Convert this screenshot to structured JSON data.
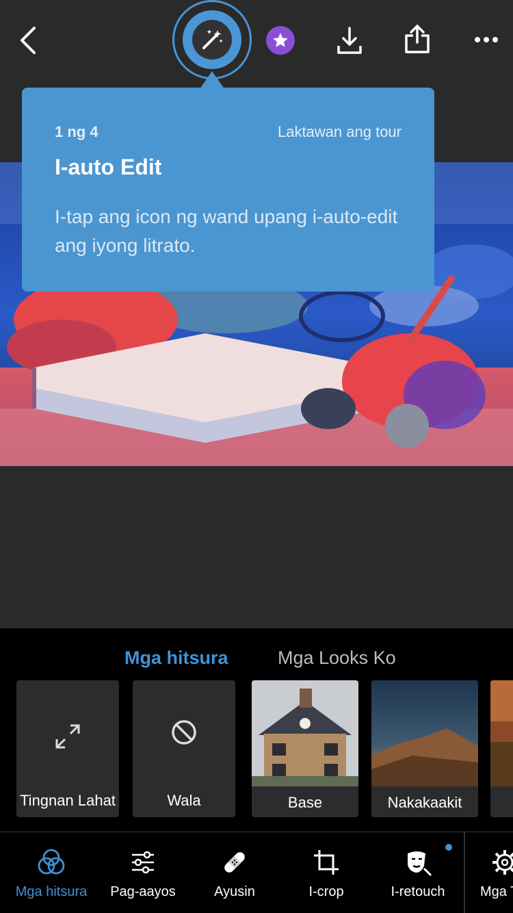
{
  "toolbar_top": {
    "icons": [
      "back-chevron-icon",
      "auto-wand-icon",
      "premium-star-icon",
      "download-icon",
      "share-icon",
      "more-icon"
    ]
  },
  "tooltip": {
    "step": "1 ng 4",
    "skip": "Laktawan ang tour",
    "title": "I-auto Edit",
    "body": "I-tap ang icon ng wand upang i-auto-edit ang iyong litrato."
  },
  "looks": {
    "tabs": [
      {
        "label": "Mga hitsura",
        "active": true
      },
      {
        "label": "Mga Looks Ko",
        "active": false
      }
    ],
    "cards": [
      {
        "label": "Tingnan Lahat",
        "icon": "expand-arrows-icon"
      },
      {
        "label": "Wala",
        "icon": "none-circle-icon"
      },
      {
        "label": "Base",
        "icon": "house-photo"
      },
      {
        "label": "Nakakaakit",
        "icon": "mountain-photo"
      }
    ]
  },
  "bottom_tools": [
    {
      "label": "Mga hitsura",
      "icon": "presets-circles-icon",
      "active": true
    },
    {
      "label": "Pag-aayos",
      "icon": "sliders-icon",
      "active": false
    },
    {
      "label": "Ayusin",
      "icon": "bandage-icon",
      "active": false
    },
    {
      "label": "I-crop",
      "icon": "crop-icon",
      "active": false
    },
    {
      "label": "I-retouch",
      "icon": "retouch-face-icon",
      "active": false,
      "badge": true
    },
    {
      "label": "Mga T",
      "icon": "gear-icon",
      "active": false
    }
  ],
  "colors": {
    "accent": "#3f93d7",
    "tooltip_bg": "#4b96d0",
    "premium": "#8a4fd6",
    "background": "#2a2a2b"
  }
}
